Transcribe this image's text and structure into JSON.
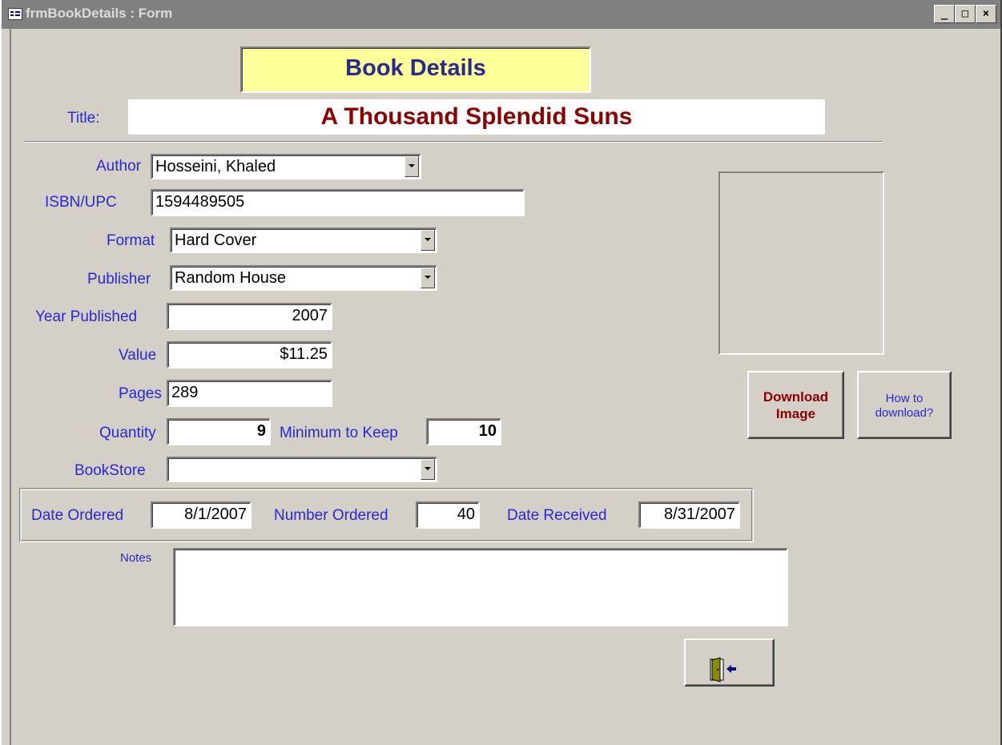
{
  "window": {
    "title": "frmBookDetails : Form",
    "minimize": "_",
    "maximize": "□",
    "close": "×"
  },
  "form": {
    "header": "Book Details",
    "title_label": "Title:",
    "title_value": "A Thousand Splendid Suns",
    "author_label": "Author",
    "author_value": "Hosseini, Khaled",
    "isbn_label": "ISBN/UPC",
    "isbn_value": "1594489505",
    "format_label": "Format",
    "format_value": "Hard Cover",
    "publisher_label": "Publisher",
    "publisher_value": "Random House",
    "year_label": "Year Published",
    "year_value": "2007",
    "value_label": "Value",
    "value_value": "$11.25",
    "pages_label": "Pages",
    "pages_value": "289",
    "quantity_label": "Quantity",
    "quantity_value": "9",
    "minimum_label": "Minimum to Keep",
    "minimum_value": "10",
    "bookstore_label": "BookStore",
    "bookstore_value": "",
    "date_ordered_label": "Date Ordered",
    "date_ordered_value": "8/1/2007",
    "number_ordered_label": "Number Ordered",
    "number_ordered_value": "40",
    "date_received_label": "Date Received",
    "date_received_value": "8/31/2007",
    "notes_label": "Notes",
    "notes_value": ""
  },
  "buttons": {
    "download_line1": "Download",
    "download_line2": "Image",
    "howto_line1": "How to",
    "howto_line2": "download?",
    "exit_icon": "exit-door-icon"
  },
  "colors": {
    "label": "#2828d8",
    "title": "#8b0000",
    "header_bg": "#ffff99",
    "header_text": "#2a2a8e",
    "download_text": "#8b0000"
  }
}
